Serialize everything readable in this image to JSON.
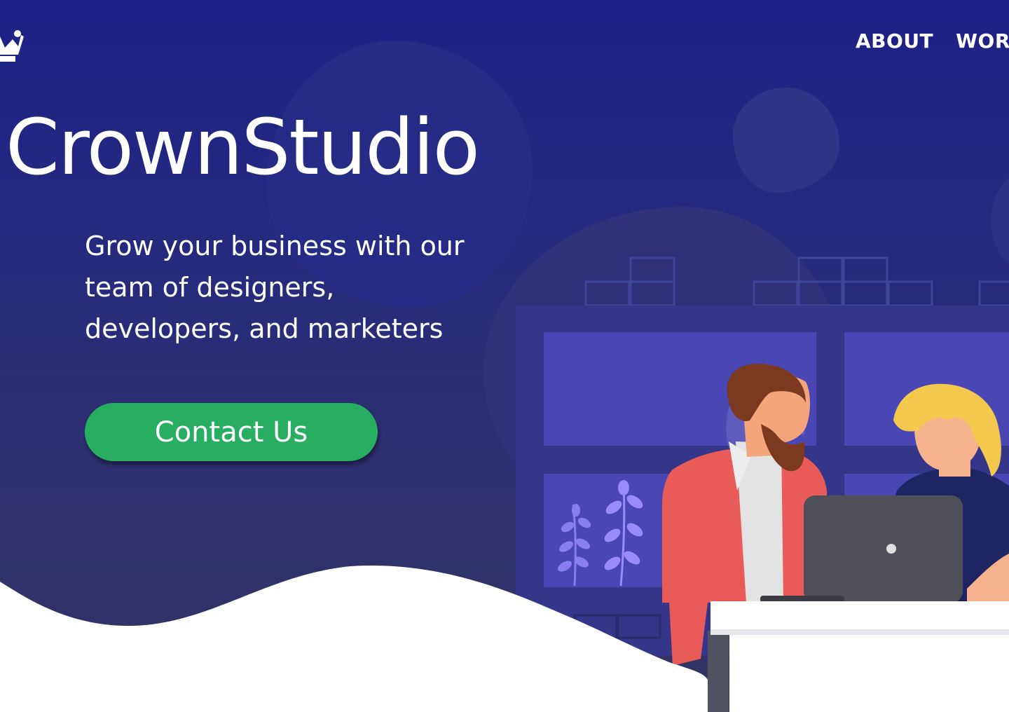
{
  "brand": {
    "name": "CrownStudio",
    "logo_icon": "crown-icon"
  },
  "nav": {
    "items": [
      {
        "label": "ABOUT"
      },
      {
        "label": "WORK"
      }
    ]
  },
  "hero": {
    "title": "CrownStudio",
    "tagline": "Grow your business with our team of designers, developers, and marketers",
    "cta_label": "Contact Us"
  },
  "colors": {
    "hero_gradient_top": "#1c2186",
    "hero_gradient_bottom": "#333564",
    "cta_green": "#27ae60",
    "text": "#ffffff",
    "wave": "#ffffff"
  }
}
